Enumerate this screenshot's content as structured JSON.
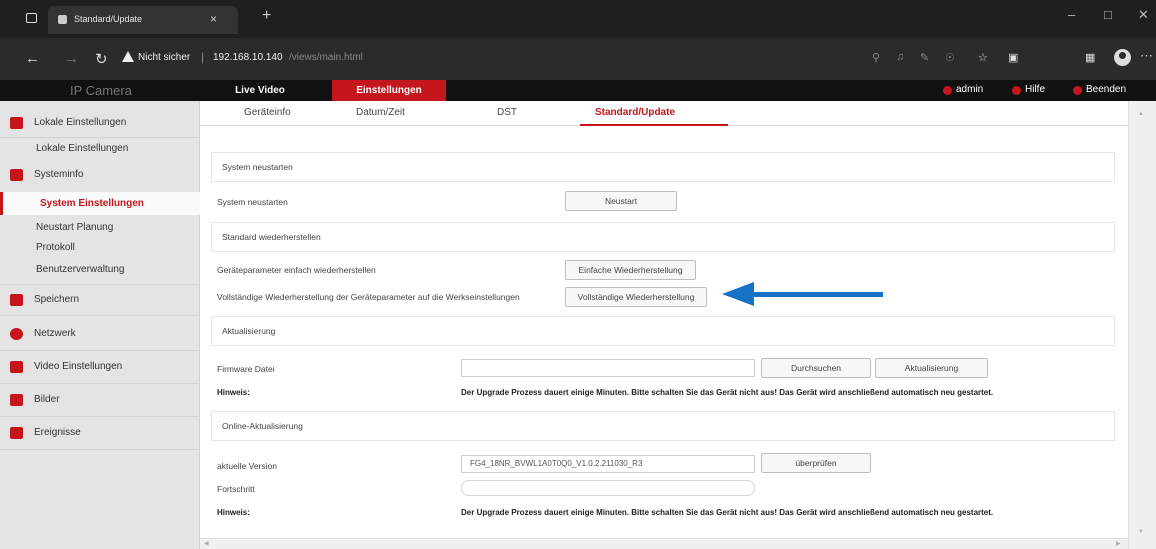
{
  "browser": {
    "tab_title": "Standard/Update",
    "tab_close": "×",
    "new_tab": "+",
    "address_warning": "Nicht sicher",
    "address_separator": "|",
    "address_host": "192.168.10.140",
    "address_path": "/views/main.html"
  },
  "app": {
    "brand": "IP Camera",
    "main_tabs": [
      {
        "label": "Live Video"
      },
      {
        "label": "Einstellungen"
      }
    ],
    "header_links": {
      "user": "admin",
      "help": "Hilfe",
      "logout": "Beenden"
    }
  },
  "sidebar": {
    "groups": [
      {
        "label": "Lokale Einstellungen",
        "icon": "monitor-icon"
      },
      {
        "label": "Systeminfo",
        "icon": "info-icon"
      },
      {
        "label": "Speichern",
        "icon": "storage-icon"
      },
      {
        "label": "Netzwerk",
        "icon": "network-icon"
      },
      {
        "label": "Video Einstellungen",
        "icon": "video-icon"
      },
      {
        "label": "Bilder",
        "icon": "image-icon"
      },
      {
        "label": "Ereignisse",
        "icon": "event-icon"
      }
    ],
    "sub_items": [
      {
        "label": "Lokale Einstellungen"
      },
      {
        "label": "System Einstellungen",
        "active": true
      },
      {
        "label": "Neustart Planung"
      },
      {
        "label": "Protokoll"
      },
      {
        "label": "Benutzerverwaltung"
      }
    ]
  },
  "subtabs": [
    {
      "label": "Geräteinfo"
    },
    {
      "label": "Datum/Zeit"
    },
    {
      "label": "DST"
    },
    {
      "label": "Standard/Update",
      "active": true
    }
  ],
  "sections": {
    "restart": {
      "title": "System neustarten",
      "label": "System neustarten",
      "button": "Neustart"
    },
    "restore": {
      "title": "Standard wiederherstellen",
      "simple_label": "Geräteparameter einfach wiederherstellen",
      "simple_button": "Einfache Wiederherstellung",
      "full_label": "Vollständige Wiederherstellung der Geräteparameter auf die Werkseinstellungen",
      "full_button": "Vollständige Wiederherstellung"
    },
    "update": {
      "title": "Aktualisierung",
      "file_label": "Firmware Datei",
      "file_value": "",
      "browse_button": "Durchsuchen",
      "update_button": "Aktualisierung",
      "hint_label": "Hinweis:",
      "hint_text": "Der Upgrade Prozess dauert einige Minuten. Bitte schalten Sie das Gerät nicht aus! Das Gerät wird anschließend automatisch neu gestartet."
    },
    "online": {
      "title": "Online-Aktualisierung",
      "version_label": "aktuelle Version",
      "version_value": "FG4_18NR_BVWL1A0T0Q0_V1.0.2.211030_R3",
      "check_button": "überprüfen",
      "progress_label": "Fortschritt",
      "progress": 0,
      "hint_label": "Hinweis:",
      "hint_text": "Der Upgrade Prozess dauert einige Minuten. Bitte schalten Sie das Gerät nicht aus! Das Gerät wird anschließend automatisch neu gestartet."
    }
  },
  "colors": {
    "accent": "#c4161c",
    "annotation_arrow": "#1672c6",
    "header_bg": "#111111",
    "sidebar_bg": "#e4e4e4"
  }
}
